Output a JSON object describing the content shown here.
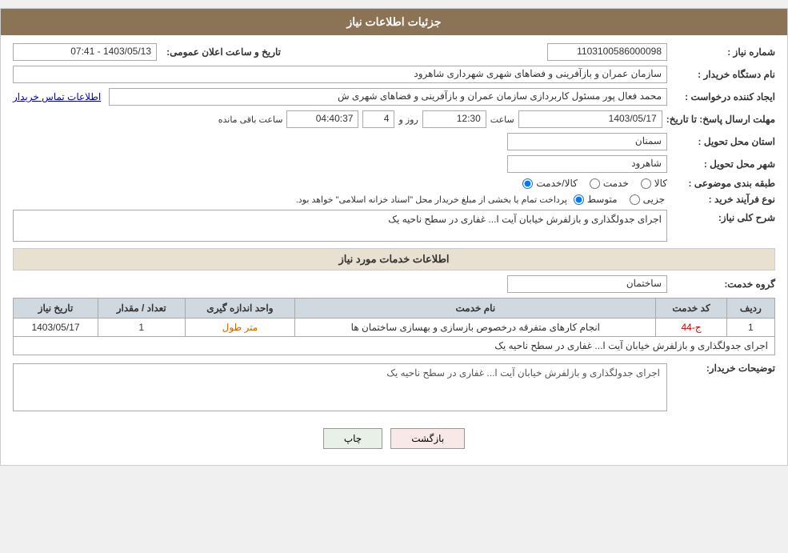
{
  "header": {
    "title": "جزئیات اطلاعات نیاز"
  },
  "fields": {
    "shomareNiaz_label": "شماره نیاز :",
    "shomareNiaz_value": "1103100586000098",
    "namDastgah_label": "نام دستگاه خریدار :",
    "namDastgah_value": "سازمان عمران و بازآفرینی و فضاهای شهری شهرداری شاهرود",
    "tarikh_label": "تاریخ و ساعت اعلان عمومی:",
    "tarikh_value": "1403/05/13 - 07:41",
    "ijad_label": "ایجاد کننده درخواست :",
    "ijad_value": "محمد فعال پور مسئول کاربردازی سازمان عمران و بازآفرینی و فضاهای شهری ش",
    "ijad_link": "اطلاعات تماس خریدار",
    "mohlat_label": "مهلت ارسال پاسخ: تا تاریخ:",
    "mohlat_date": "1403/05/17",
    "mohlat_saat_label": "ساعت",
    "mohlat_saat": "12:30",
    "mohlat_rooz_label": "روز و",
    "mohlat_rooz": "4",
    "mohlat_remaining_label": "ساعت باقی مانده",
    "mohlat_remaining": "04:40:37",
    "ostan_label": "استان محل تحویل :",
    "ostan_value": "سمنان",
    "shahr_label": "شهر محل تحویل :",
    "shahr_value": "شاهرود",
    "tabaghebandi_label": "طبقه بندی موضوعی :",
    "tabaghebandi_options": [
      "کالا",
      "خدمت",
      "کالا/خدمت"
    ],
    "tabaghebandi_selected": "کالا/خدمت",
    "noFarayand_label": "نوع فرآیند خرید :",
    "noFarayand_options": [
      "جزیی",
      "متوسط"
    ],
    "noFarayand_selected": "متوسط",
    "noFarayand_note": "پرداخت تمام یا بخشی از مبلغ خریدار محل \"اسناد خزانه اسلامی\" خواهد بود.",
    "sharh_label": "شرح کلی نیاز:",
    "sharh_value": "اجرای جدولگذاری و بازلفرش خیابان آیت ا... غفاری در سطح ناحیه یک",
    "services_section": "اطلاعات خدمات مورد نیاز",
    "group_label": "گروه خدمت:",
    "group_value": "ساختمان",
    "table": {
      "headers": [
        "ردیف",
        "کد خدمت",
        "نام خدمت",
        "واحد اندازه گیری",
        "تعداد / مقدار",
        "تاریخ نیاز"
      ],
      "rows": [
        {
          "radif": "1",
          "kod": "ج-44",
          "name": "انجام کارهای متفرقه درخصوص بازسازی و بهسازی ساختمان ها",
          "vahed": "متر طول",
          "tedad": "1",
          "tarikh": "1403/05/17"
        }
      ]
    },
    "tozi_label": "توضیحات خریدار:",
    "tozi_value": "اجرای جدولگذاری و بازلفرش خیابان آیت ا... غفاری در سطح ناحیه یک"
  },
  "buttons": {
    "print": "چاپ",
    "back": "بازگشت"
  }
}
